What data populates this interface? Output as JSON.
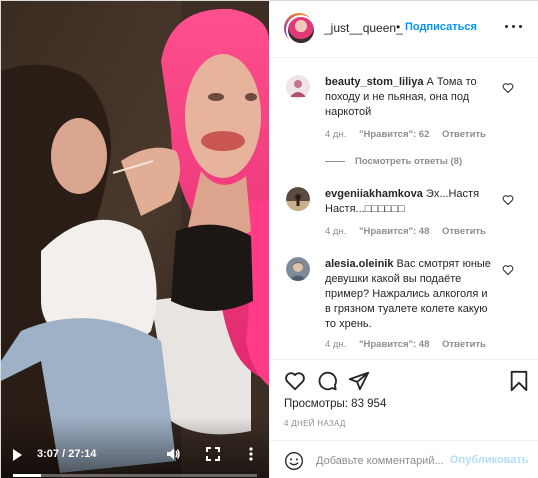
{
  "header": {
    "username": "_just__queen_",
    "separator": "•",
    "follow_label": "Подписаться"
  },
  "video": {
    "current_time": "3:07",
    "duration": "27:14",
    "time_separator": " / ",
    "progress_fraction": 0.114
  },
  "comments": [
    {
      "username": "beauty_stom_liliya",
      "text": "А Тома то походу и не пьяная, она под наркотой",
      "age": "4 дн.",
      "likes": "\"Нравится\": 62",
      "reply_label": "Ответить",
      "view_replies": "Посмотреть ответы (8)"
    },
    {
      "username": "evgeniiakhamkova",
      "text": "Эх...Настя Настя...□□□□□□",
      "age": "4 дн.",
      "likes": "\"Нравится\": 48",
      "reply_label": "Ответить"
    },
    {
      "username": "alesia.oleinik",
      "text": "Вас смотрят юные девушки какой вы подаёте пример? Нажрались алкоголя и в грязном туалете колете какую то хрень.",
      "age": "4 дн.",
      "likes": "\"Нравится\": 48",
      "reply_label": "Ответить"
    }
  ],
  "actions": {
    "views": "Просмотры: 83 954",
    "posted": "4 ДНЕЙ НАЗАД"
  },
  "add_comment": {
    "placeholder": "Добавьте комментарий...",
    "publish_label": "Опубликовать"
  },
  "colors": {
    "accent": "#0095f6",
    "publish_disabled": "#b2dffc",
    "muted_text": "#8e8e8e",
    "text": "#262626"
  }
}
